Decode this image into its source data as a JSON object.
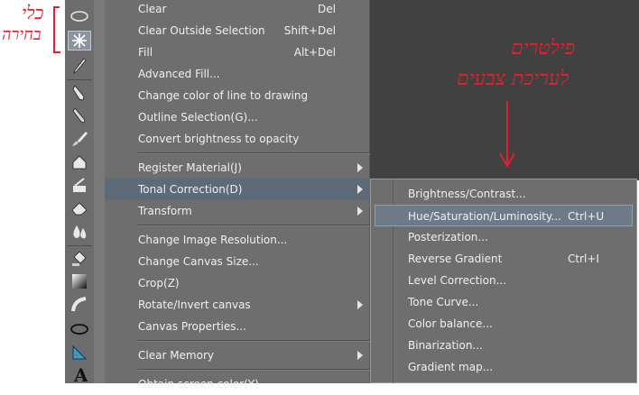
{
  "annotations": {
    "left_line1": "כלי",
    "left_line2": "בחירה",
    "right_line1": "פילטרים",
    "right_line2": "לעריכת צבעים"
  },
  "main_menu": {
    "items": [
      {
        "label": "Clear",
        "shortcut": "Del"
      },
      {
        "label": "Clear Outside Selection",
        "shortcut": "Shift+Del"
      },
      {
        "label": "Fill",
        "shortcut": "Alt+Del"
      },
      {
        "label": "Advanced Fill...",
        "shortcut": ""
      },
      {
        "label": "Change color of line to drawing",
        "shortcut": ""
      },
      {
        "label": "Outline Selection(G)...",
        "shortcut": ""
      },
      {
        "label": "Convert brightness to opacity",
        "shortcut": ""
      },
      {
        "label": "Register Material(J)",
        "shortcut": ""
      },
      {
        "label": "Tonal Correction(D)",
        "shortcut": ""
      },
      {
        "label": "Transform",
        "shortcut": ""
      },
      {
        "label": "Change Image Resolution...",
        "shortcut": ""
      },
      {
        "label": "Change Canvas Size...",
        "shortcut": ""
      },
      {
        "label": "Crop(Z)",
        "shortcut": ""
      },
      {
        "label": "Rotate/Invert canvas",
        "shortcut": ""
      },
      {
        "label": "Canvas Properties...",
        "shortcut": ""
      },
      {
        "label": "Clear Memory",
        "shortcut": ""
      },
      {
        "label": "Obtain screen color(Y)",
        "shortcut": ""
      }
    ]
  },
  "submenu": {
    "items": [
      {
        "label": "Brightness/Contrast...",
        "shortcut": ""
      },
      {
        "label": "Hue/Saturation/Luminosity...",
        "shortcut": "Ctrl+U"
      },
      {
        "label": "Posterization...",
        "shortcut": ""
      },
      {
        "label": "Reverse Gradient",
        "shortcut": "Ctrl+I"
      },
      {
        "label": "Level Correction...",
        "shortcut": ""
      },
      {
        "label": "Tone Curve...",
        "shortcut": ""
      },
      {
        "label": "Color balance...",
        "shortcut": ""
      },
      {
        "label": "Binarization...",
        "shortcut": ""
      },
      {
        "label": "Gradient map...",
        "shortcut": ""
      }
    ]
  },
  "toolbar": {
    "tools": [
      "ellipse-selection-icon",
      "auto-select-wand-icon",
      "eyedropper-icon",
      "pen-icon",
      "pencil-icon",
      "brush-icon",
      "airbrush-icon",
      "decoration-icon",
      "eraser-icon",
      "blend-icon",
      "fill-bucket-icon",
      "gradient-icon",
      "figure-line-icon",
      "ellipse-figure-icon",
      "ruler-icon",
      "text-icon"
    ]
  },
  "colors": {
    "annotation": "#e0202a",
    "menu_bg": "#6e6e6e",
    "highlight": "#5d6a78",
    "canvas": "#414141"
  }
}
